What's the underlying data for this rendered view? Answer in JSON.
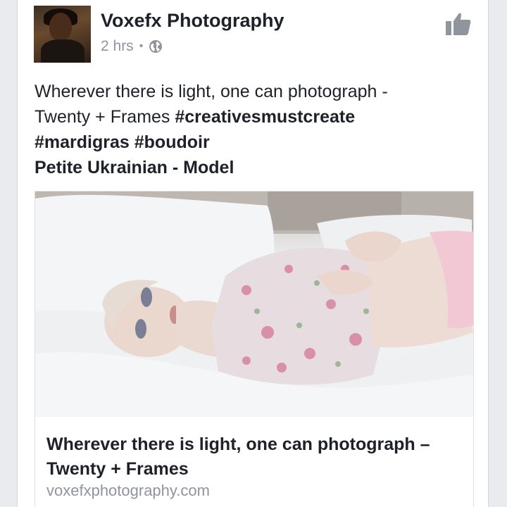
{
  "post": {
    "page_name": "Voxefx Photography",
    "time": "2 hrs",
    "separator": "•",
    "privacy_icon": "globe-icon",
    "like_icon": "thumbs-up-icon",
    "text": {
      "line1": "Wherever there is light, one can photograph -",
      "line2_plain": "Twenty + Frames ",
      "hashtag1": "#creativesmustcreate",
      "hashtag2": "#mardigras",
      "hashtag3": "#boudoir",
      "line4": "Petite Ukrainian - Model"
    }
  },
  "link_preview": {
    "title": "Wherever there is light, one can photograph – Twenty + Frames",
    "domain": "voxefxphotography.com"
  },
  "colors": {
    "text_primary": "#1d2129",
    "text_secondary": "#90949c",
    "icon_gray": "#90949c",
    "background": "#e9ebee",
    "card": "#ffffff"
  }
}
